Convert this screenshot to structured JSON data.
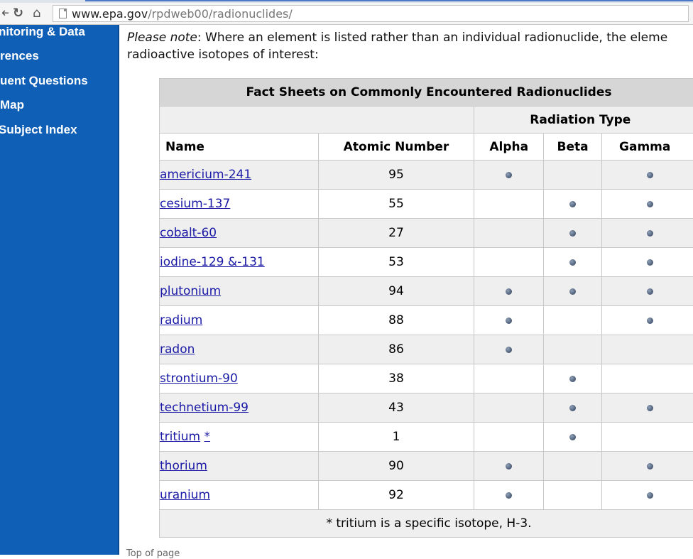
{
  "browser": {
    "url_host": "www.epa.gov",
    "url_path": "/rpdweb00/radionuclides/"
  },
  "sidebar": {
    "items": [
      {
        "label": "nitoring & Data"
      },
      {
        "label": "rences"
      },
      {
        "label": "uent Questions"
      },
      {
        "label": "Map"
      },
      {
        "label": "Subject Index"
      }
    ]
  },
  "note": {
    "label": "Please note",
    "line1_rest": ": Where an element is listed rather than an individual radionuclide, the eleme",
    "line2": "radioactive isotopes of interest:"
  },
  "table": {
    "caption": "Fact Sheets on Commonly Encountered Radionuclides",
    "group_header": "Radiation Type",
    "headers": {
      "name": "Name",
      "atomic": "Atomic Number",
      "alpha": "Alpha",
      "beta": "Beta",
      "gamma": "Gamma"
    },
    "rows": [
      {
        "name": "americium-241",
        "atomic": "95",
        "alpha": true,
        "beta": false,
        "gamma": true
      },
      {
        "name": "cesium-137",
        "atomic": "55",
        "alpha": false,
        "beta": true,
        "gamma": true
      },
      {
        "name": "cobalt-60",
        "atomic": "27",
        "alpha": false,
        "beta": true,
        "gamma": true
      },
      {
        "name": "iodine-129 &-131",
        "atomic": "53",
        "alpha": false,
        "beta": true,
        "gamma": true
      },
      {
        "name": "plutonium",
        "atomic": "94",
        "alpha": true,
        "beta": true,
        "gamma": true
      },
      {
        "name": "radium",
        "atomic": "88",
        "alpha": true,
        "beta": false,
        "gamma": true
      },
      {
        "name": "radon",
        "atomic": "86",
        "alpha": true,
        "beta": false,
        "gamma": false
      },
      {
        "name": "strontium-90",
        "atomic": "38",
        "alpha": false,
        "beta": true,
        "gamma": false
      },
      {
        "name": "technetium-99",
        "atomic": "43",
        "alpha": false,
        "beta": true,
        "gamma": true
      },
      {
        "name": "tritium",
        "atomic": "1",
        "alpha": false,
        "beta": true,
        "gamma": false,
        "footnote_mark": "*"
      },
      {
        "name": "thorium",
        "atomic": "90",
        "alpha": true,
        "beta": false,
        "gamma": true
      },
      {
        "name": "uranium",
        "atomic": "92",
        "alpha": true,
        "beta": false,
        "gamma": true
      }
    ],
    "footnote": "* tritium is a specific isotope, H-3."
  },
  "footer": {
    "top_link": "Top of page"
  },
  "icons": {
    "back": "back-arrow-icon",
    "reload": "reload-icon",
    "home": "home-icon",
    "page": "page-icon",
    "dot": "radiation-dot-icon"
  },
  "colors": {
    "sidebar": "#0f5fb6",
    "link": "#1a1aa6",
    "caption_bg": "#d6d6d6",
    "row_alt": "#efefef"
  }
}
